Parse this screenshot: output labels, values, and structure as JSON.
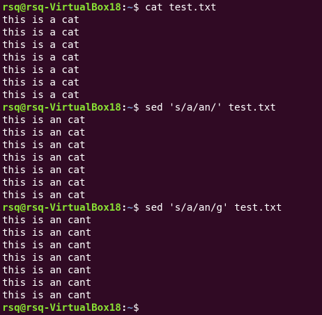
{
  "terminal": {
    "colors": {
      "background": "#300a24",
      "text": "#ffffff",
      "prompt_user": "#8ae234",
      "prompt_path": "#729fcf"
    },
    "prompt": {
      "user_host": "rsq@rsq-VirtualBox18",
      "colon": ":",
      "path": "~",
      "symbol": "$"
    },
    "blocks": [
      {
        "command": "cat test.txt",
        "output": [
          "this is a cat",
          "this is a cat",
          "this is a cat",
          "this is a cat",
          "this is a cat",
          "this is a cat",
          "this is a cat"
        ]
      },
      {
        "command": "sed 's/a/an/' test.txt",
        "output": [
          "this is an cat",
          "this is an cat",
          "this is an cat",
          "this is an cat",
          "this is an cat",
          "this is an cat",
          "this is an cat"
        ]
      },
      {
        "command": "sed 's/a/an/g' test.txt",
        "output": [
          "this is an cant",
          "this is an cant",
          "this is an cant",
          "this is an cant",
          "this is an cant",
          "this is an cant",
          "this is an cant"
        ]
      }
    ],
    "final_prompt_command": ""
  }
}
